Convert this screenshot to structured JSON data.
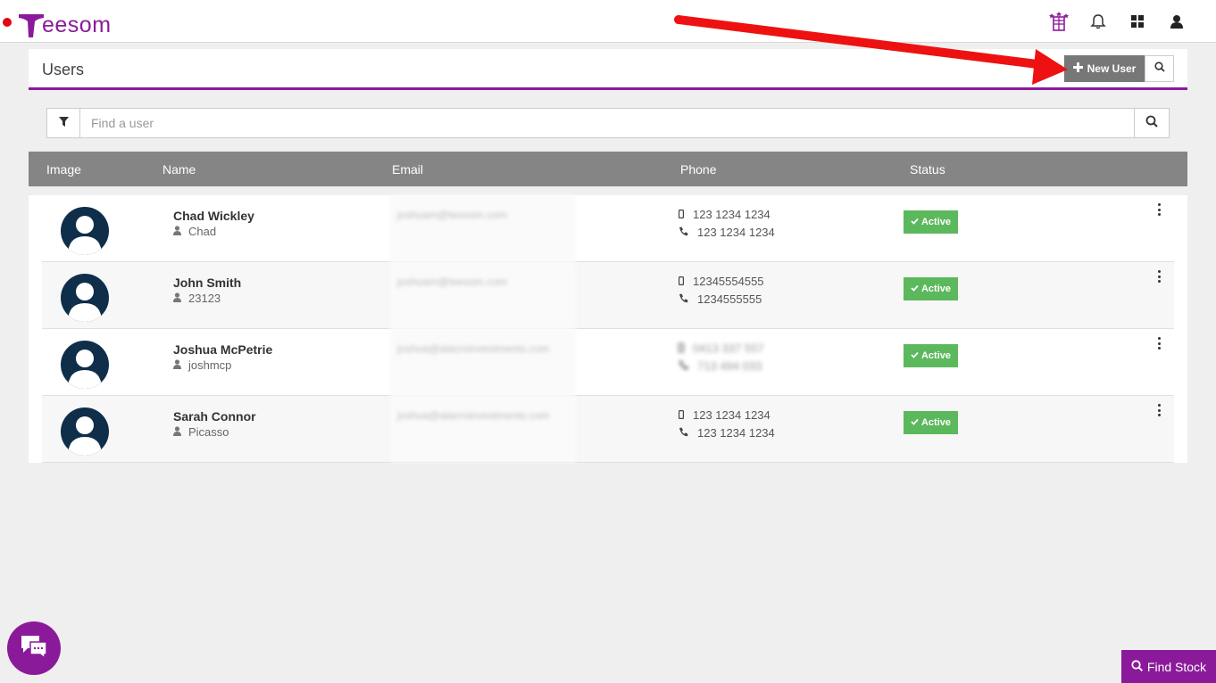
{
  "app": {
    "logo_text": "eesom",
    "logo_full": "Teesom"
  },
  "topbar": {
    "icons": [
      "castle-icon",
      "bell-icon",
      "grid-icon",
      "user-icon"
    ]
  },
  "header": {
    "title": "Users",
    "new_user_label": "New User"
  },
  "search": {
    "placeholder": "Find a user"
  },
  "table": {
    "columns": [
      "Image",
      "Name",
      "Email",
      "Phone",
      "Status"
    ],
    "rows": [
      {
        "name": "Chad Wickley",
        "login": "Chad",
        "email": "joshuam@teesom.com",
        "phone_mobile": "123 1234 1234",
        "phone_landline": "123 1234 1234",
        "status": "Active"
      },
      {
        "name": "John Smith",
        "login": "23123",
        "email": "joshuam@teesom.com",
        "phone_mobile": "12345554555",
        "phone_landline": "1234555555",
        "status": "Active"
      },
      {
        "name": "Joshua McPetrie",
        "login": "joshmcp",
        "email": "joshua@alacroinvestments.com",
        "phone_mobile": "0413 337 557",
        "phone_landline": "713 494 033",
        "status": "Active"
      },
      {
        "name": "Sarah Connor",
        "login": "Picasso",
        "email": "joshua@alacroinvestments.com",
        "phone_mobile": "123 1234 1234",
        "phone_landline": "123 1234 1234",
        "status": "Active"
      }
    ]
  },
  "footer": {
    "find_stock_label": "Find Stock"
  },
  "colors": {
    "brand": "#8b1a9a",
    "status_active": "#5cb85c",
    "header_gray": "#858585",
    "annotation_arrow": "#ee1111"
  }
}
